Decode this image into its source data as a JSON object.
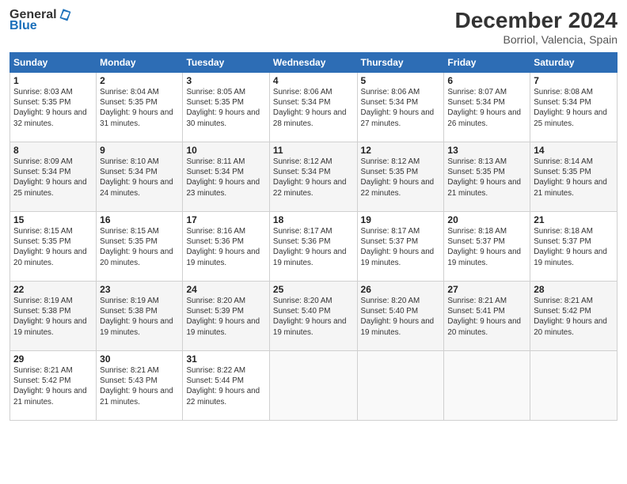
{
  "header": {
    "logo_general": "General",
    "logo_blue": "Blue",
    "month": "December 2024",
    "location": "Borriol, Valencia, Spain"
  },
  "days_of_week": [
    "Sunday",
    "Monday",
    "Tuesday",
    "Wednesday",
    "Thursday",
    "Friday",
    "Saturday"
  ],
  "weeks": [
    [
      {
        "day": "1",
        "sunrise": "8:03 AM",
        "sunset": "5:35 PM",
        "daylight": "9 hours and 32 minutes."
      },
      {
        "day": "2",
        "sunrise": "8:04 AM",
        "sunset": "5:35 PM",
        "daylight": "9 hours and 31 minutes."
      },
      {
        "day": "3",
        "sunrise": "8:05 AM",
        "sunset": "5:35 PM",
        "daylight": "9 hours and 30 minutes."
      },
      {
        "day": "4",
        "sunrise": "8:06 AM",
        "sunset": "5:34 PM",
        "daylight": "9 hours and 28 minutes."
      },
      {
        "day": "5",
        "sunrise": "8:06 AM",
        "sunset": "5:34 PM",
        "daylight": "9 hours and 27 minutes."
      },
      {
        "day": "6",
        "sunrise": "8:07 AM",
        "sunset": "5:34 PM",
        "daylight": "9 hours and 26 minutes."
      },
      {
        "day": "7",
        "sunrise": "8:08 AM",
        "sunset": "5:34 PM",
        "daylight": "9 hours and 25 minutes."
      }
    ],
    [
      {
        "day": "8",
        "sunrise": "8:09 AM",
        "sunset": "5:34 PM",
        "daylight": "9 hours and 25 minutes."
      },
      {
        "day": "9",
        "sunrise": "8:10 AM",
        "sunset": "5:34 PM",
        "daylight": "9 hours and 24 minutes."
      },
      {
        "day": "10",
        "sunrise": "8:11 AM",
        "sunset": "5:34 PM",
        "daylight": "9 hours and 23 minutes."
      },
      {
        "day": "11",
        "sunrise": "8:12 AM",
        "sunset": "5:34 PM",
        "daylight": "9 hours and 22 minutes."
      },
      {
        "day": "12",
        "sunrise": "8:12 AM",
        "sunset": "5:35 PM",
        "daylight": "9 hours and 22 minutes."
      },
      {
        "day": "13",
        "sunrise": "8:13 AM",
        "sunset": "5:35 PM",
        "daylight": "9 hours and 21 minutes."
      },
      {
        "day": "14",
        "sunrise": "8:14 AM",
        "sunset": "5:35 PM",
        "daylight": "9 hours and 21 minutes."
      }
    ],
    [
      {
        "day": "15",
        "sunrise": "8:15 AM",
        "sunset": "5:35 PM",
        "daylight": "9 hours and 20 minutes."
      },
      {
        "day": "16",
        "sunrise": "8:15 AM",
        "sunset": "5:35 PM",
        "daylight": "9 hours and 20 minutes."
      },
      {
        "day": "17",
        "sunrise": "8:16 AM",
        "sunset": "5:36 PM",
        "daylight": "9 hours and 19 minutes."
      },
      {
        "day": "18",
        "sunrise": "8:17 AM",
        "sunset": "5:36 PM",
        "daylight": "9 hours and 19 minutes."
      },
      {
        "day": "19",
        "sunrise": "8:17 AM",
        "sunset": "5:37 PM",
        "daylight": "9 hours and 19 minutes."
      },
      {
        "day": "20",
        "sunrise": "8:18 AM",
        "sunset": "5:37 PM",
        "daylight": "9 hours and 19 minutes."
      },
      {
        "day": "21",
        "sunrise": "8:18 AM",
        "sunset": "5:37 PM",
        "daylight": "9 hours and 19 minutes."
      }
    ],
    [
      {
        "day": "22",
        "sunrise": "8:19 AM",
        "sunset": "5:38 PM",
        "daylight": "9 hours and 19 minutes."
      },
      {
        "day": "23",
        "sunrise": "8:19 AM",
        "sunset": "5:38 PM",
        "daylight": "9 hours and 19 minutes."
      },
      {
        "day": "24",
        "sunrise": "8:20 AM",
        "sunset": "5:39 PM",
        "daylight": "9 hours and 19 minutes."
      },
      {
        "day": "25",
        "sunrise": "8:20 AM",
        "sunset": "5:40 PM",
        "daylight": "9 hours and 19 minutes."
      },
      {
        "day": "26",
        "sunrise": "8:20 AM",
        "sunset": "5:40 PM",
        "daylight": "9 hours and 19 minutes."
      },
      {
        "day": "27",
        "sunrise": "8:21 AM",
        "sunset": "5:41 PM",
        "daylight": "9 hours and 20 minutes."
      },
      {
        "day": "28",
        "sunrise": "8:21 AM",
        "sunset": "5:42 PM",
        "daylight": "9 hours and 20 minutes."
      }
    ],
    [
      {
        "day": "29",
        "sunrise": "8:21 AM",
        "sunset": "5:42 PM",
        "daylight": "9 hours and 21 minutes."
      },
      {
        "day": "30",
        "sunrise": "8:21 AM",
        "sunset": "5:43 PM",
        "daylight": "9 hours and 21 minutes."
      },
      {
        "day": "31",
        "sunrise": "8:22 AM",
        "sunset": "5:44 PM",
        "daylight": "9 hours and 22 minutes."
      },
      null,
      null,
      null,
      null
    ]
  ],
  "labels": {
    "sunrise": "Sunrise:",
    "sunset": "Sunset:",
    "daylight": "Daylight:"
  }
}
